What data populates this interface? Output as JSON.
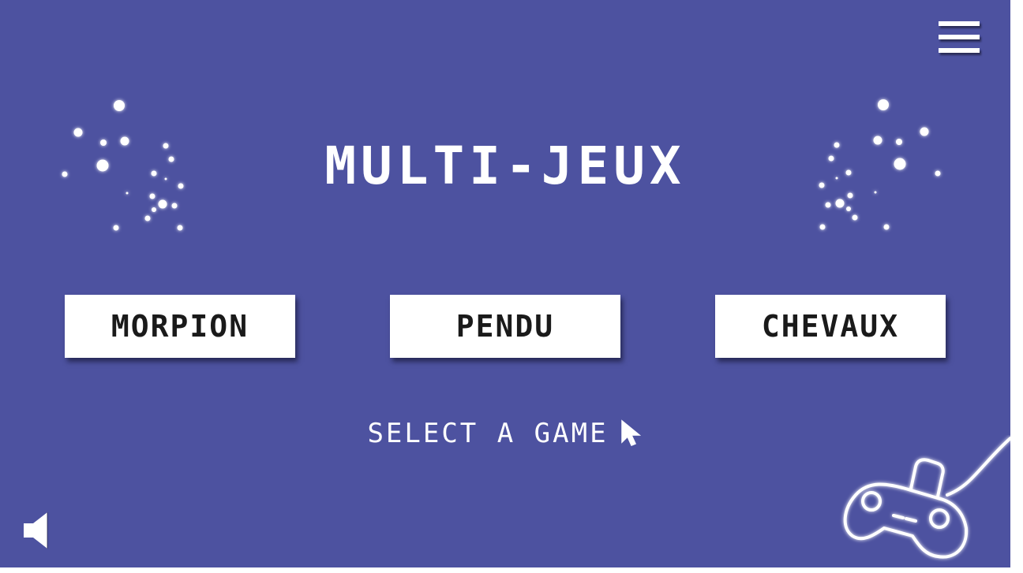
{
  "app": {
    "title": "MULTI-JEUX"
  },
  "games": {
    "morpion_label": "MORPION",
    "pendu_label": "PENDU",
    "chevaux_label": "CHEVAUX"
  },
  "prompt": {
    "select_label": "SELECT A GAME"
  },
  "icons": {
    "menu": "hamburger-menu-icon",
    "sound": "speaker-icon",
    "cursor": "mouse-pointer-icon",
    "controller": "gamepad-icon",
    "decoration": "sparkles-icon"
  },
  "colors": {
    "background": "#4d52a0",
    "button_bg": "#ffffff",
    "button_text": "#1a1a1a",
    "foreground": "#ffffff"
  }
}
